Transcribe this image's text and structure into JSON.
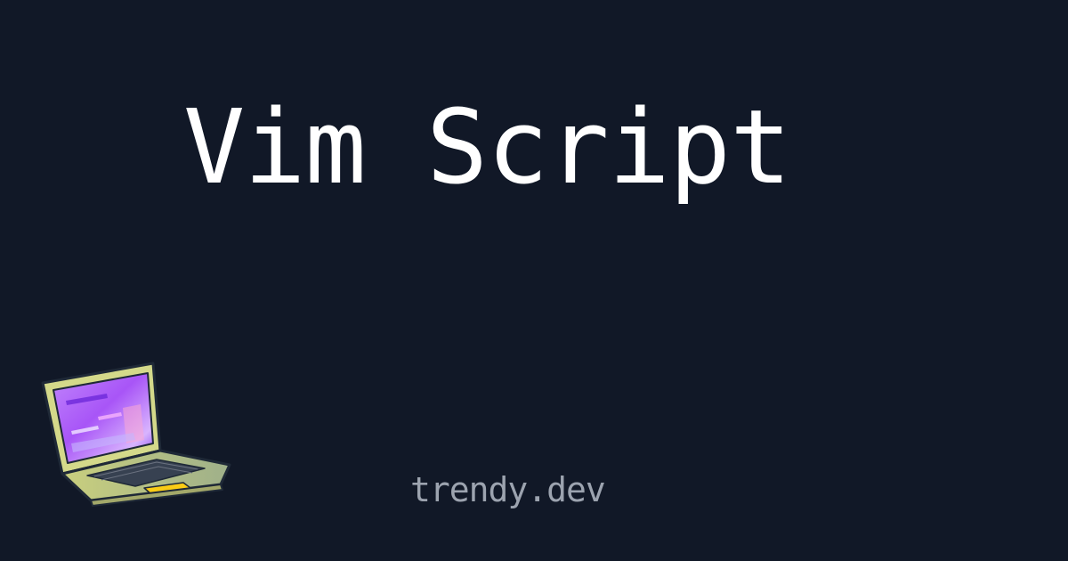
{
  "page": {
    "title": "Vim Script",
    "site": "trendy.dev"
  },
  "colors": {
    "background": "#111827",
    "title": "#ffffff",
    "site": "#9ca3af",
    "laptop_body": "#d4d98a",
    "laptop_screen": "#a855f7"
  },
  "icons": {
    "illustration": "laptop-icon"
  }
}
